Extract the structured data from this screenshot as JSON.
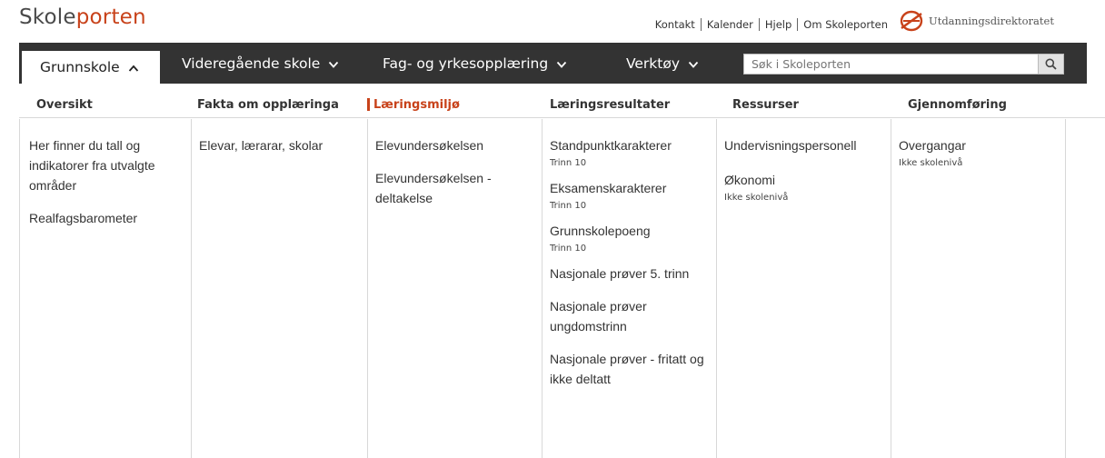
{
  "logo": {
    "part1": "Skole",
    "part2": "porten"
  },
  "toplinks": [
    "Kontakt",
    "Kalender",
    "Hjelp",
    "Om Skoleporten"
  ],
  "udir": {
    "name": "Utdanningsdirektoratet",
    "icon": "udir-logo-icon",
    "color": "#c8421a"
  },
  "nav": {
    "items": [
      {
        "label": "Grunnskole",
        "icon": "chevron-up-icon",
        "active": true
      },
      {
        "label": "Videregående skole",
        "icon": "chevron-down-icon"
      },
      {
        "label": "Fag- og yrkesopplæring",
        "icon": "chevron-down-icon"
      },
      {
        "label": "Verktøy",
        "icon": "chevron-down-icon"
      }
    ],
    "search": {
      "placeholder": "Søk i Skoleporten",
      "icon": "search-icon"
    }
  },
  "columns": [
    {
      "header": "Oversikt",
      "items": [
        {
          "label": "Her finner du tall og indikatorer fra utvalgte områder"
        },
        {
          "label": "Realfagsbarometer"
        }
      ]
    },
    {
      "header": "Fakta om opplæringa",
      "items": [
        {
          "label": "Elevar, lærarar, skolar"
        }
      ]
    },
    {
      "header": "Læringsmiljø",
      "active": true,
      "items": [
        {
          "label": "Elevundersøkelsen"
        },
        {
          "label": "Elevundersøkelsen - deltakelse"
        }
      ]
    },
    {
      "header": "Læringsresultater",
      "items": [
        {
          "label": "Standpunktkarakterer",
          "sub": "Trinn 10"
        },
        {
          "label": "Eksamenskarakterer",
          "sub": "Trinn 10"
        },
        {
          "label": "Grunnskolepoeng",
          "sub": "Trinn 10"
        },
        {
          "label": "Nasjonale prøver 5. trinn"
        },
        {
          "label": "Nasjonale prøver ungdomstrinn"
        },
        {
          "label": "Nasjonale prøver - fritatt og ikke deltatt"
        }
      ]
    },
    {
      "header": "Ressurser",
      "items": [
        {
          "label": "Undervisningspersonell"
        },
        {
          "label": "Økonomi",
          "sub": "Ikke skolenivå"
        }
      ]
    },
    {
      "header": "Gjennomføring",
      "items": [
        {
          "label": "Overgangar",
          "sub": "Ikke skolenivå"
        }
      ]
    }
  ],
  "colors": {
    "accent": "#c8421a",
    "navbar": "#333333"
  }
}
